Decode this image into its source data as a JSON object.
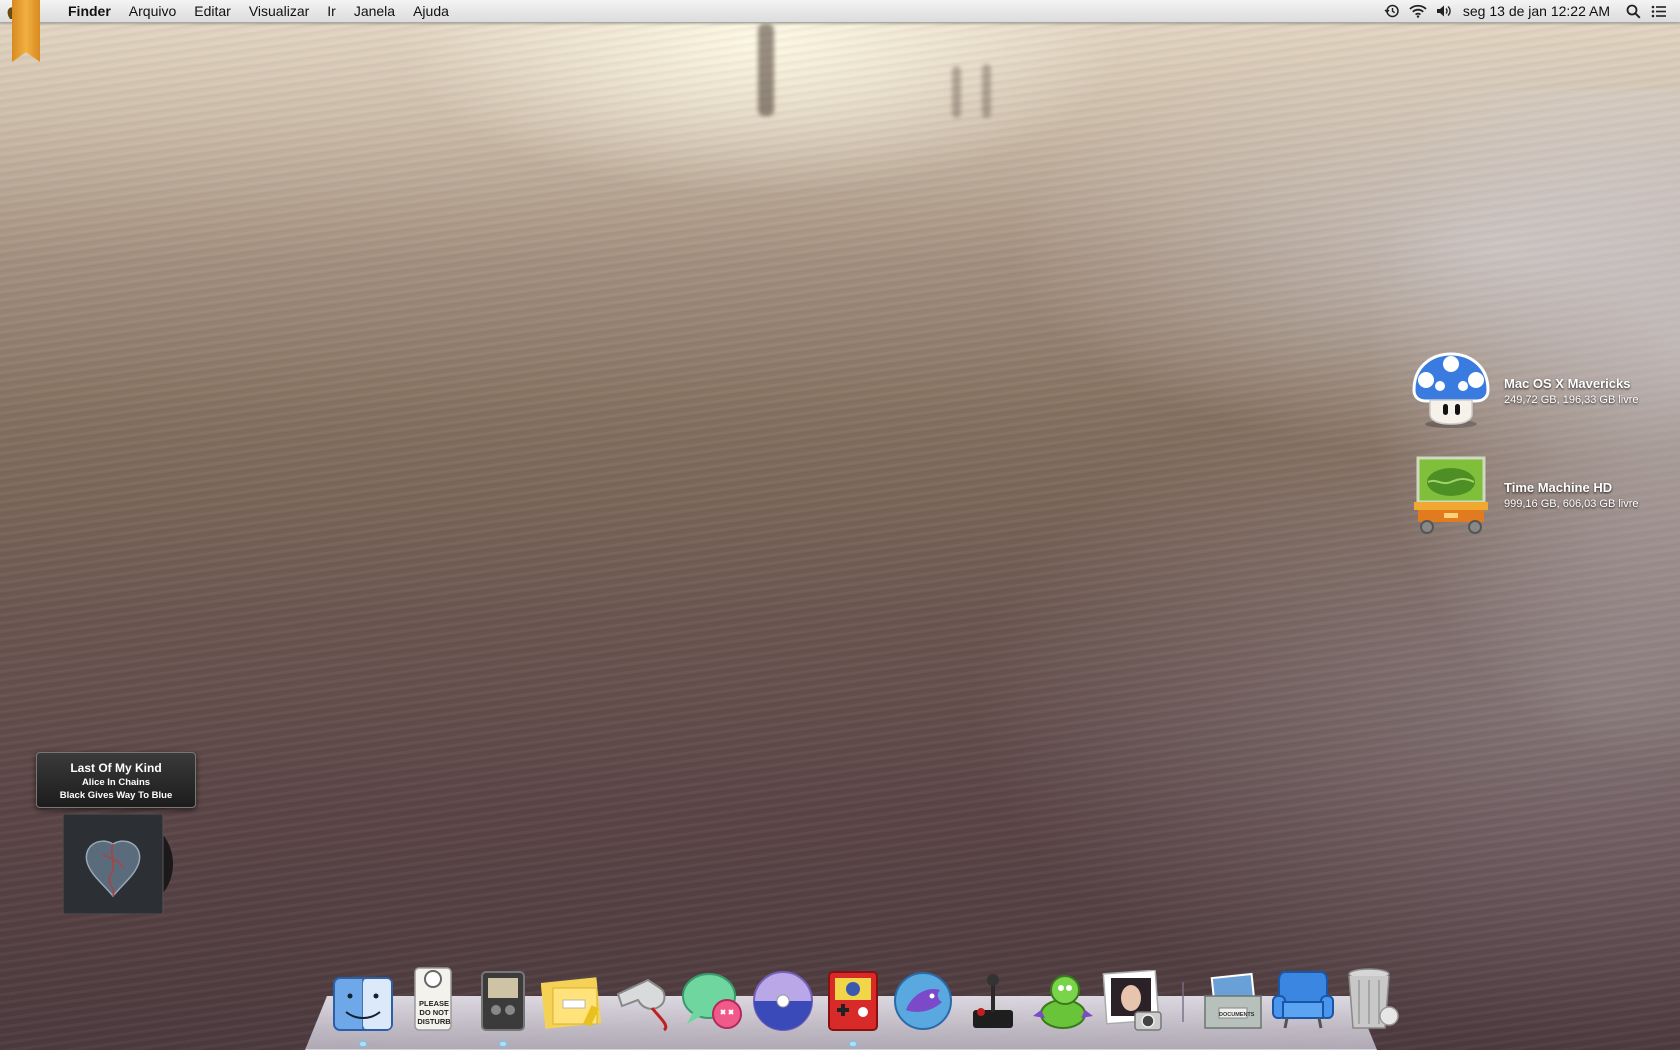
{
  "menubar": {
    "app_name": "Finder",
    "menus": [
      "Arquivo",
      "Editar",
      "Visualizar",
      "Ir",
      "Janela",
      "Ajuda"
    ],
    "clock": "seg 13 de jan  12:22 AM",
    "status_icons": [
      "time-machine-icon",
      "wifi-icon",
      "volume-icon",
      "spotlight-icon",
      "notification-center-icon"
    ]
  },
  "desktop": {
    "items": [
      {
        "name": "Mac OS X Mavericks",
        "info": "249,72 GB, 196,33 GB livre",
        "icon": "mushroom-drive-icon"
      },
      {
        "name": "Time Machine HD",
        "info": "999,16 GB, 606,03 GB livre",
        "icon": "time-machine-cart-icon"
      }
    ]
  },
  "now_playing": {
    "title": "Last Of My Kind",
    "artist": "Alice In Chains",
    "album": "Black Gives Way To Blue"
  },
  "dock": {
    "apps": [
      "finder-icon",
      "do-not-disturb-icon",
      "cassette-icon",
      "stickies-notes-icon",
      "whistle-icon",
      "messages-icon",
      "dvd-player-icon",
      "gameboy-app-icon",
      "fish-browser-icon",
      "joystick-icon",
      "dragon-icon",
      "photo-booth-icon"
    ],
    "others": [
      "documents-stack-icon",
      "armchair-icon",
      "trash-icon"
    ],
    "do_not_disturb_text": "PLEASE DO NOT DISTURB",
    "documents_label": "DOCUMENTS"
  },
  "colors": {
    "menubar": "#e6e6e6",
    "ribbon": "#f2b040",
    "run_indicator": "#9ee6ff"
  }
}
